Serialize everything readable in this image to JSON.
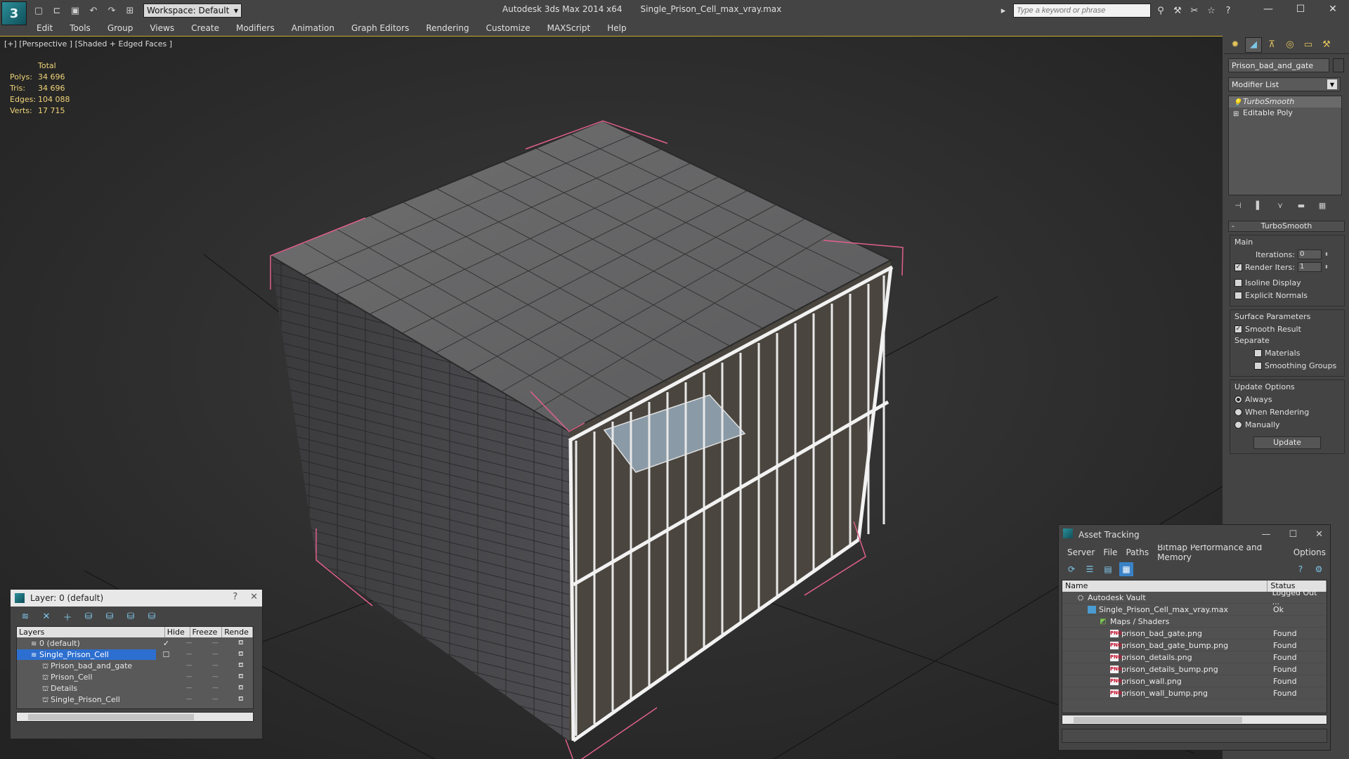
{
  "app": {
    "title": "Autodesk 3ds Max  2014 x64",
    "filename": "Single_Prison_Cell_max_vray.max",
    "workspace_label": "Workspace: Default",
    "search_placeholder": "Type a keyword or phrase",
    "logo_glyph": "3"
  },
  "menu": [
    "Edit",
    "Tools",
    "Group",
    "Views",
    "Create",
    "Modifiers",
    "Animation",
    "Graph Editors",
    "Rendering",
    "Customize",
    "MAXScript",
    "Help"
  ],
  "viewport": {
    "label": "[+] [Perspective ] [Shaded + Edged Faces ]",
    "stats": {
      "header": "Total",
      "rows": [
        {
          "k": "Polys:",
          "v": "34 696"
        },
        {
          "k": "Tris:",
          "v": "34 696"
        },
        {
          "k": "Edges:",
          "v": "104 088"
        },
        {
          "k": "Verts:",
          "v": "17 715"
        }
      ]
    }
  },
  "command_panel": {
    "object_name": "Prison_bad_and_gate",
    "modifier_list": "Modifier List",
    "stack": [
      {
        "label": "TurboSmooth",
        "selected": true
      },
      {
        "label": "Editable Poly",
        "selected": false
      }
    ],
    "rollout_title": "TurboSmooth",
    "main_label": "Main",
    "iterations_label": "Iterations:",
    "iterations_value": "0",
    "render_iters_label": "Render Iters:",
    "render_iters_value": "1",
    "isoline_label": "Isoline Display",
    "explicit_normals_label": "Explicit Normals",
    "surface_params_label": "Surface Parameters",
    "smooth_result_label": "Smooth Result",
    "separate_label": "Separate",
    "materials_label": "Materials",
    "smoothing_groups_label": "Smoothing Groups",
    "update_options_label": "Update Options",
    "always_label": "Always",
    "when_rendering_label": "When Rendering",
    "manually_label": "Manually",
    "update_button": "Update"
  },
  "layer_dialog": {
    "title": "Layer: 0 (default)",
    "help": "?",
    "close": "✕",
    "columns": [
      "Layers",
      "Hide",
      "Freeze",
      "Rende"
    ],
    "rows": [
      {
        "name": "0 (default)",
        "indent": 1,
        "selected": false
      },
      {
        "name": "Single_Prison_Cell",
        "indent": 1,
        "selected": true
      },
      {
        "name": "Prison_bad_and_gate",
        "indent": 2,
        "selected": false
      },
      {
        "name": "Prison_Cell",
        "indent": 2,
        "selected": false
      },
      {
        "name": "Details",
        "indent": 2,
        "selected": false
      },
      {
        "name": "Single_Prison_Cell",
        "indent": 2,
        "selected": false
      }
    ]
  },
  "asset_dialog": {
    "title": "Asset Tracking",
    "menu": [
      "Server",
      "File",
      "Paths",
      "Bitmap Performance and Memory",
      "Options"
    ],
    "columns": [
      "Name",
      "Status"
    ],
    "rows": [
      {
        "name": "Autodesk Vault",
        "status": "Logged Out ...",
        "indent": 1,
        "icon": "vault"
      },
      {
        "name": "Single_Prison_Cell_max_vray.max",
        "status": "Ok",
        "indent": 2,
        "icon": "file"
      },
      {
        "name": "Maps / Shaders",
        "status": "",
        "indent": 3,
        "icon": "folder"
      },
      {
        "name": "prison_bad_gate.png",
        "status": "Found",
        "indent": 4,
        "icon": "png"
      },
      {
        "name": "prison_bad_gate_bump.png",
        "status": "Found",
        "indent": 4,
        "icon": "png"
      },
      {
        "name": "prison_details.png",
        "status": "Found",
        "indent": 4,
        "icon": "png"
      },
      {
        "name": "prison_details_bump.png",
        "status": "Found",
        "indent": 4,
        "icon": "png"
      },
      {
        "name": "prison_wall.png",
        "status": "Found",
        "indent": 4,
        "icon": "png"
      },
      {
        "name": "prison_wall_bump.png",
        "status": "Found",
        "indent": 4,
        "icon": "png"
      }
    ]
  },
  "colors": {
    "viewport_bg": "#2b2b2b",
    "active_border": "#c9a72b",
    "stats_text": "#f0d478",
    "selection_blue": "#2d6fd0"
  }
}
